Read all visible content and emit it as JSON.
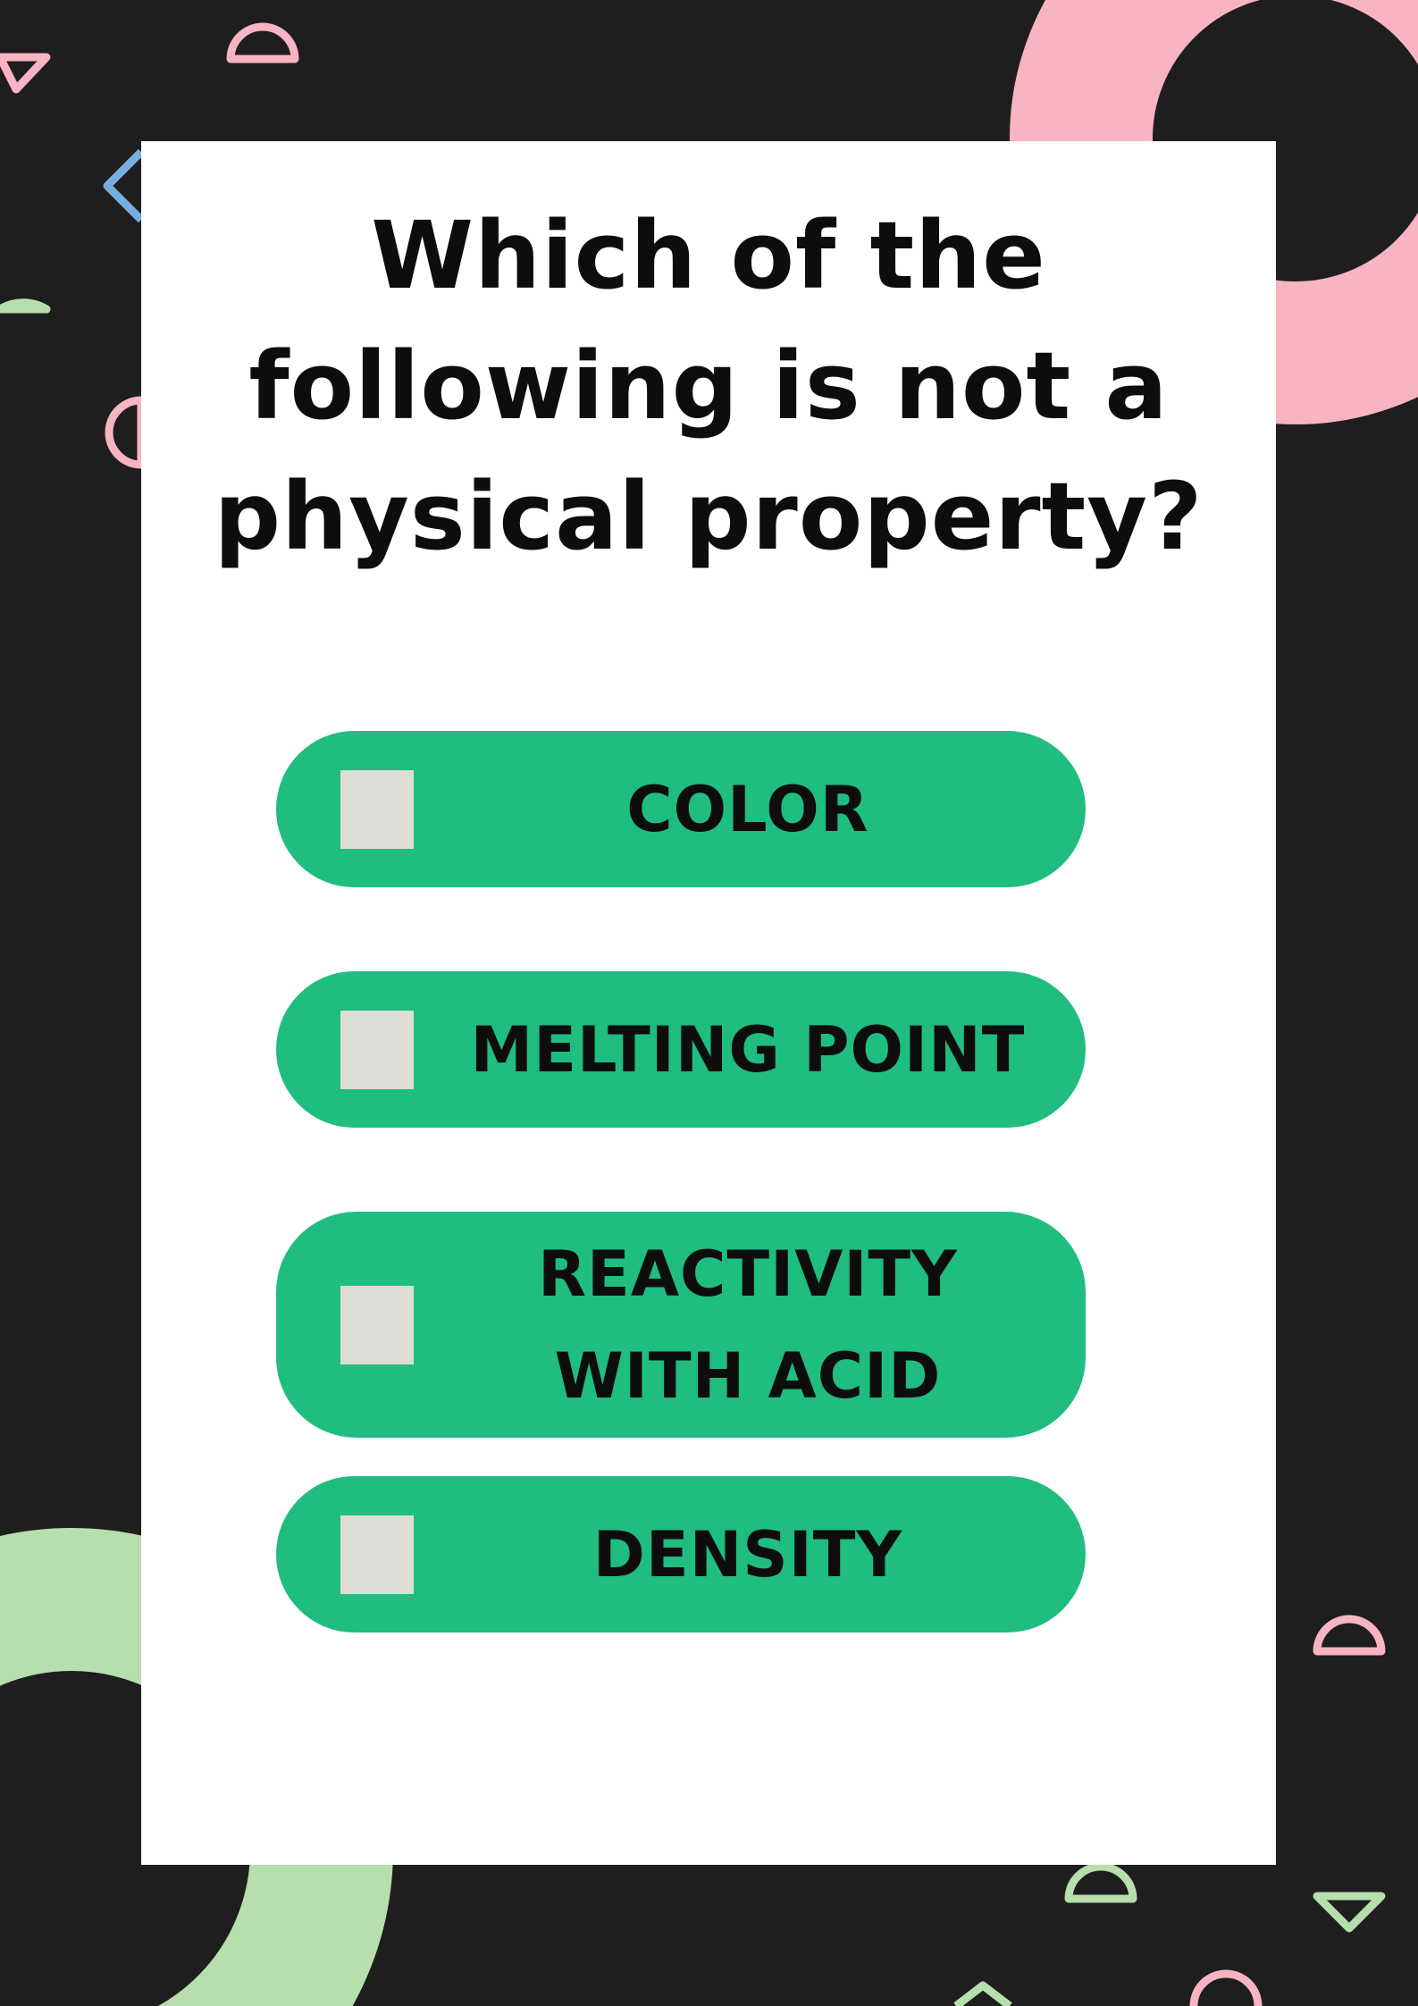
{
  "quiz": {
    "question": "Which of the following is not a physical property?",
    "options": [
      {
        "label": "COLOR"
      },
      {
        "label": "MELTING POINT"
      },
      {
        "label": "REACTIVITY WITH ACID"
      },
      {
        "label": "DENSITY"
      }
    ]
  },
  "theme": {
    "background": "#1e1e1e",
    "card": "#ffffff",
    "option_fill": "#1fbd7f",
    "checkbox_fill": "#dedcd6",
    "text": "#0d0d0d",
    "accent_pink": "#f8b4c2",
    "accent_green": "#b7dead",
    "accent_blue": "#77aee0"
  },
  "decorations": [
    "pink-ring-shape",
    "green-ring-shape",
    "semicircle-outline-icon",
    "triangle-outline-icon",
    "diamond-outline-icon"
  ]
}
